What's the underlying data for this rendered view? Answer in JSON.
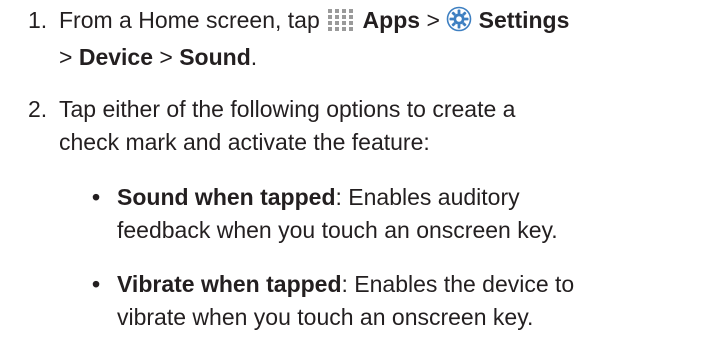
{
  "steps": [
    {
      "number": "1.",
      "line1": {
        "text1": "From a Home screen, tap",
        "apps_icon": "apps-grid-icon",
        "apps_label": "Apps",
        "sep1": ">",
        "settings_icon": "settings-gear-icon",
        "settings_label": "Settings"
      },
      "line2": {
        "sep2": ">",
        "device_label": "Device",
        "sep3": ">",
        "sound_label": "Sound",
        "end": "."
      }
    },
    {
      "number": "2.",
      "line1": "Tap either of the following options to create a",
      "line2": "check mark and activate the feature:"
    }
  ],
  "bullets": [
    {
      "marker": "•",
      "term": "Sound when tapped",
      "line1_rest": ": Enables auditory",
      "line2": "feedback when you touch an onscreen key."
    },
    {
      "marker": "•",
      "term": "Vibrate when tapped",
      "line1_rest": ": Enables the device to",
      "line2": "vibrate when you touch an onscreen key."
    }
  ],
  "colors": {
    "text": "#231f20",
    "icon_grey": "#9a9a9a",
    "gear_blue": "#3d7fc1"
  }
}
